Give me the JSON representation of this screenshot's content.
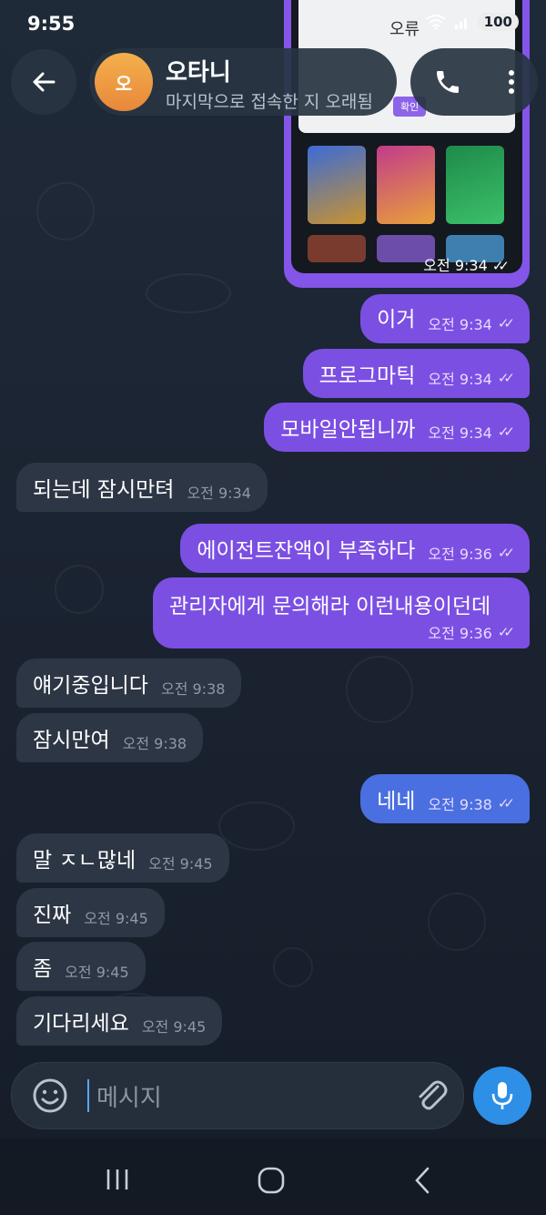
{
  "status_bar": {
    "time": "9:55",
    "battery": "100"
  },
  "header": {
    "avatar_letter": "오",
    "contact_name": "오타니",
    "last_seen": "마지막으로 접속한 지 오래됨"
  },
  "preview": {
    "dialog_title": "오류",
    "dialog_button": "확인",
    "time": "오전 9:34"
  },
  "messages": [
    {
      "dir": "out",
      "text": "이거",
      "time": "오전 9:34"
    },
    {
      "dir": "out",
      "text": "프로그마틱",
      "time": "오전 9:34"
    },
    {
      "dir": "out",
      "text": "모바일안됩니까",
      "time": "오전 9:34"
    },
    {
      "dir": "in",
      "text": "되는데 잠시만텨",
      "time": "오전 9:34"
    },
    {
      "dir": "out",
      "text": "에이전트잔액이 부족하다",
      "time": "오전 9:36"
    },
    {
      "dir": "out",
      "text": "관리자에게 문의해라 이런내용이던데",
      "time": "오전 9:36"
    },
    {
      "dir": "in",
      "text": "얘기중입니다",
      "time": "오전 9:38"
    },
    {
      "dir": "in",
      "text": "잠시만여",
      "time": "오전 9:38"
    },
    {
      "dir": "out",
      "text": "네네",
      "time": "오전 9:38"
    },
    {
      "dir": "in",
      "text": "말 ㅈㄴ많네",
      "time": "오전 9:45"
    },
    {
      "dir": "in",
      "text": "진짜",
      "time": "오전 9:45"
    },
    {
      "dir": "in",
      "text": "좀",
      "time": "오전 9:45"
    },
    {
      "dir": "in",
      "text": "기다리세요",
      "time": "오전 9:45"
    }
  ],
  "composer": {
    "placeholder": "메시지"
  },
  "colors": {
    "outgoing": "#7c4fe3",
    "incoming": "#2c3644",
    "mic": "#2e8fe6",
    "avatar": "#f0a045"
  },
  "icons": [
    "back-arrow-icon",
    "phone-icon",
    "more-vert-icon",
    "emoji-icon",
    "paperclip-icon",
    "mic-icon",
    "double-check-icon"
  ]
}
